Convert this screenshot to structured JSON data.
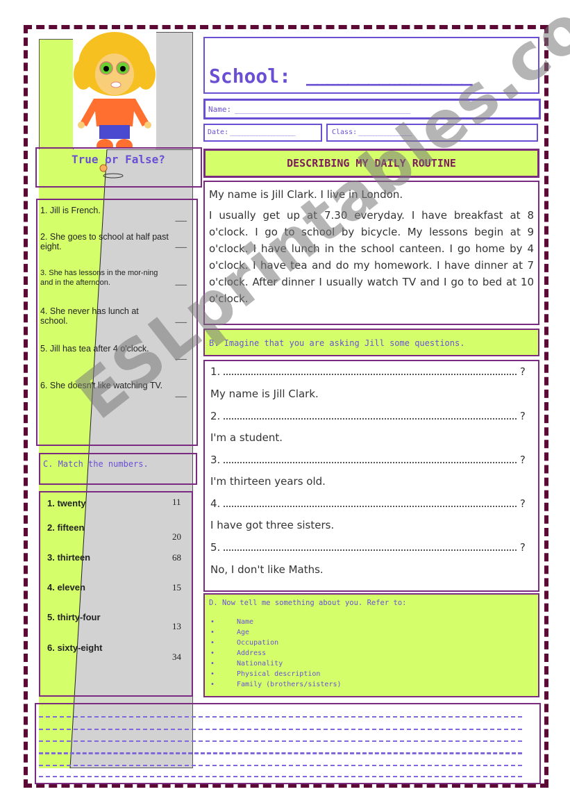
{
  "header": {
    "school_label": "School:",
    "school_blank": "________________",
    "name_label": "Name:",
    "name_blank": "________________________________________",
    "date_label": "Date:",
    "date_blank": "______________________",
    "class_label": "Class:",
    "class_blank": "__________________"
  },
  "section_a": {
    "title": "True or False?",
    "items": [
      {
        "text": "1. Jill is French.",
        "blank": "___"
      },
      {
        "text": "2. She goes to school at half past eight.",
        "blank": "___"
      },
      {
        "text": "3. She has lessons in the mor-ning and in the afternoon.",
        "blank": "___"
      },
      {
        "text": "4. She never has lunch at school.",
        "blank": "___"
      },
      {
        "text": "5. Jill has tea after 4 o'clock.",
        "blank": "___"
      },
      {
        "text": "6. She doesn't like watching TV.",
        "blank": "___"
      }
    ]
  },
  "section_c": {
    "title": "C. Match the numbers.",
    "words": [
      "1. twenty",
      "2. fifteen",
      "3. thirteen",
      "4. eleven",
      "5. thirty-four",
      "6. sixty-eight"
    ],
    "numbers": [
      "11",
      "20",
      "68",
      "15",
      "13",
      "34"
    ]
  },
  "reading": {
    "title": "DESCRIBING MY DAILY ROUTINE",
    "para1": "My name is Jill Clark. I live in London.",
    "para2": "I usually get up at 7.30 everyday. I have breakfast at 8 o'clock. I go to school by bicycle. My lessons begin at 9 o'clock. I have lunch in the school canteen. I go home by 4 o'clock. I have tea and do my homework. I have dinner at 7 o'clock.  After dinner I usually watch TV and I go to bed at 10 o'clock."
  },
  "section_b": {
    "title": "B. Imagine that you are asking Jill some questions.",
    "questions": [
      {
        "num": "1.",
        "end": "?",
        "answer": "My name is Jill Clark."
      },
      {
        "num": "2.",
        "end": "?",
        "answer": "I'm a student."
      },
      {
        "num": "3.",
        "end": "?",
        "answer": "I'm thirteen years old."
      },
      {
        "num": "4.",
        "end": "?",
        "answer": "I have got three sisters."
      },
      {
        "num": "5.",
        "end": "?",
        "answer": "No, I don't like Maths."
      }
    ]
  },
  "section_d": {
    "title": "D. Now tell me something about you. Refer to:",
    "bullets": [
      "Name",
      "Age",
      "Occupation",
      "Address",
      "Nationality",
      "Physical description",
      "Family (brothers/sisters)"
    ]
  },
  "watermark": "ESLprintables.com",
  "colors": {
    "lime": "#d4ff6a",
    "violet": "#6a4fd4",
    "purple_border": "#7a2a80",
    "page_border": "#5c0a35",
    "title_text": "#7a1a5a"
  }
}
